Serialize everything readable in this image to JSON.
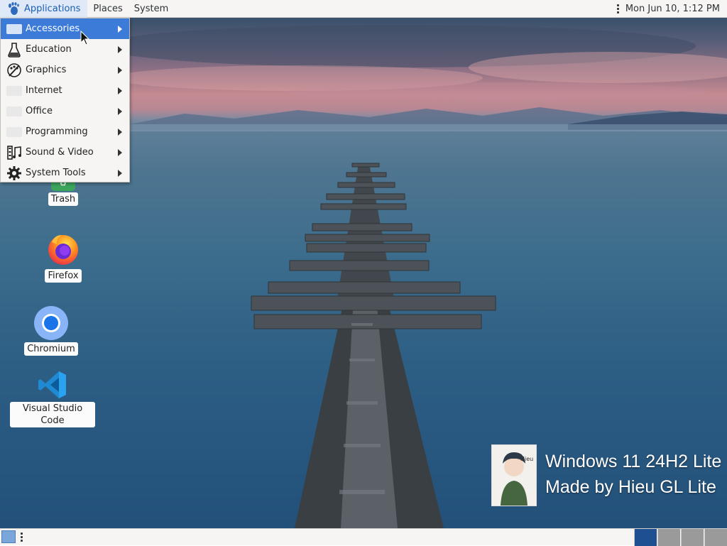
{
  "top_panel": {
    "applications_label": "Applications",
    "places_label": "Places",
    "system_label": "System",
    "clock": "Mon Jun 10,  1:12 PM"
  },
  "apps_menu": {
    "items": [
      {
        "label": "Accessories",
        "icon": "accessories-icon",
        "selected": true
      },
      {
        "label": "Education",
        "icon": "flask-icon"
      },
      {
        "label": "Graphics",
        "icon": "palette-icon"
      },
      {
        "label": "Internet",
        "icon": "internet-icon"
      },
      {
        "label": "Office",
        "icon": "office-icon"
      },
      {
        "label": "Programming",
        "icon": "programming-icon"
      },
      {
        "label": "Sound & Video",
        "icon": "film-music-icon"
      },
      {
        "label": "System Tools",
        "icon": "gear-icon"
      }
    ]
  },
  "desktop_icons": {
    "trash": "Trash",
    "firefox": "Firefox",
    "chromium": "Chromium",
    "vscode": "Visual Studio Code"
  },
  "watermark": {
    "line1": "Windows 11 24H2 Lite",
    "line2": "Made by Hieu GL Lite",
    "avatar_text": "Hieu"
  },
  "colors": {
    "accent": "#3d7bd9",
    "panel": "#f6f5f4",
    "workspace_active": "#1d4f91"
  }
}
